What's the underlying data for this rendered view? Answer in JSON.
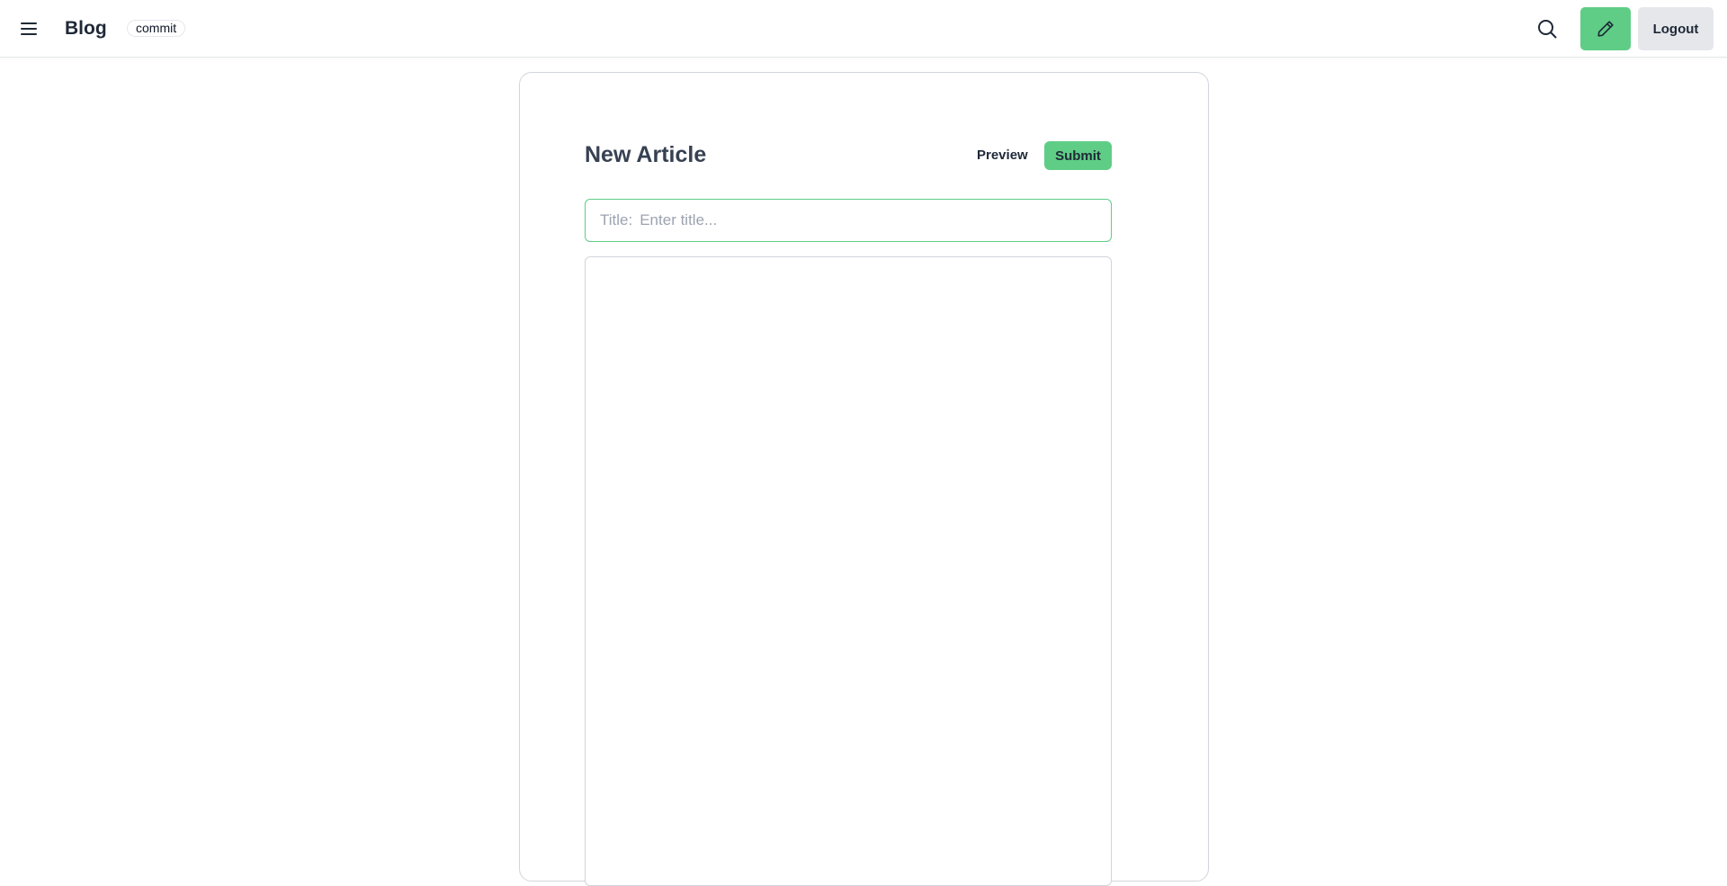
{
  "header": {
    "brand": "Blog",
    "badge": "commit",
    "logout_label": "Logout",
    "icons": {
      "menu": "hamburger-menu-icon",
      "search": "search-icon",
      "write": "pencil-icon"
    },
    "accent_color": "#5fcd86"
  },
  "editor": {
    "heading": "New Article",
    "preview_label": "Preview",
    "submit_label": "Submit",
    "title_label": "Title:",
    "title_placeholder": "Enter title...",
    "title_value": "",
    "body_value": ""
  }
}
